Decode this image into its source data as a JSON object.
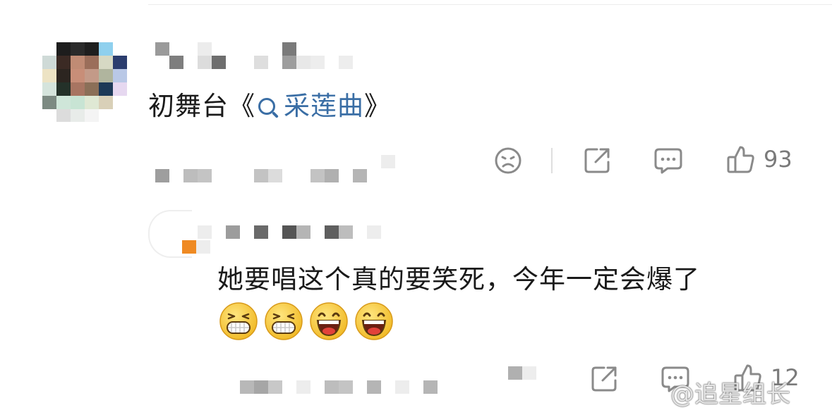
{
  "comment": {
    "text_prefix": "初舞台《",
    "link_text": "采莲曲",
    "text_suffix": "》",
    "actions": {
      "dislike_icon": "frown-face-icon",
      "share_icon": "share-icon",
      "comment_icon": "comment-bubble-icon",
      "like_icon": "thumbs-up-icon",
      "like_count": "93"
    }
  },
  "reply": {
    "text": "她要唱这个真的要笑死，今年一定会爆了",
    "emojis": [
      "grin-emoji",
      "grin-emoji",
      "laugh-emoji",
      "laugh-emoji"
    ],
    "actions": {
      "share_icon": "share-icon",
      "comment_icon": "comment-bubble-icon",
      "like_icon": "thumbs-up-icon",
      "like_count": "12"
    }
  },
  "watermark": "@追星组长",
  "colors": {
    "link": "#3a6ea5",
    "text": "#1a1a1a",
    "icon": "#8a8a8a",
    "reply_badge": "#ef8a23"
  }
}
